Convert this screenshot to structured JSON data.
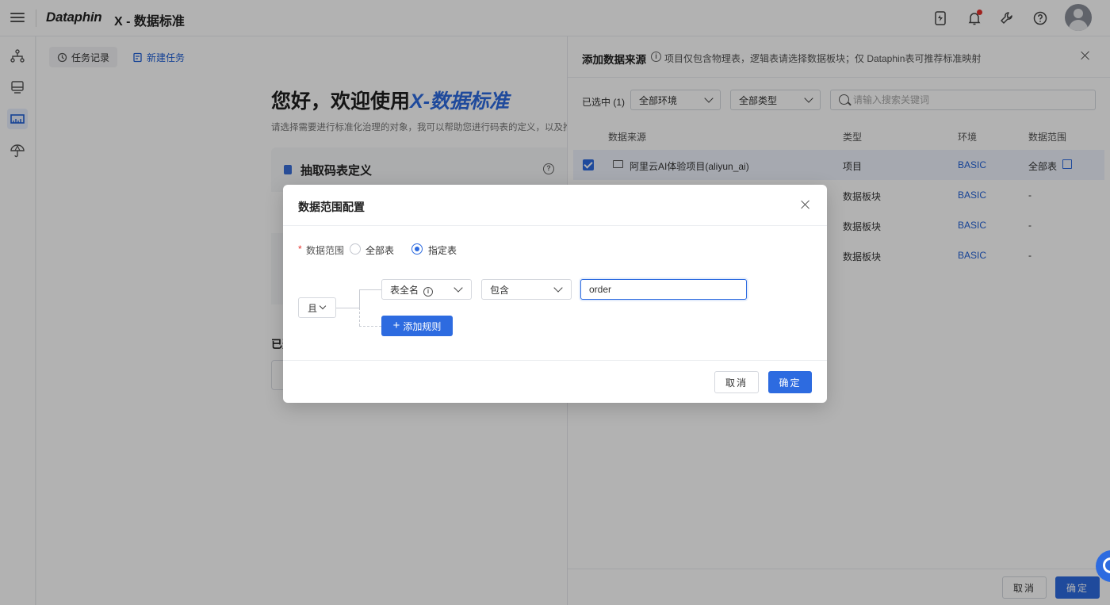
{
  "app": {
    "logo": "Dataphin",
    "title": "X - 数据标准"
  },
  "main": {
    "tabs": [
      {
        "label": "任务记录",
        "icon": "history-icon"
      },
      {
        "label": "新建任务",
        "icon": "new-task-icon"
      }
    ],
    "welcome_prefix": "您好，欢迎使用",
    "welcome_brand": "X-数据标准",
    "welcome_sub": "请选择需要进行标准化治理的对象，我可以帮助您进行码表的定义，以及推",
    "card_title": "抽取码表定义",
    "selected_label": "已选"
  },
  "drawer": {
    "title": "添加数据来源",
    "hint": "项目仅包含物理表，逻辑表请选择数据板块；仅 Dataphin表可推荐标准映射",
    "selected_count": "已选中 (1)",
    "env_filter": "全部环境",
    "type_filter": "全部类型",
    "search_placeholder": "请输入搜索关键词",
    "columns": [
      "数据来源",
      "类型",
      "环境",
      "数据范围"
    ],
    "rows": [
      {
        "source": "阿里云AI体验项目(aliyun_ai)",
        "type": "项目",
        "env": "BASIC",
        "scope": "全部表",
        "checked": true
      },
      {
        "source": "",
        "type": "数据板块",
        "env": "BASIC",
        "scope": "-",
        "checked": false
      },
      {
        "source": "",
        "type": "数据板块",
        "env": "BASIC",
        "scope": "-",
        "checked": false
      },
      {
        "source": "",
        "type": "数据板块",
        "env": "BASIC",
        "scope": "-",
        "checked": false
      }
    ],
    "cancel": "取消",
    "confirm": "确定"
  },
  "modal": {
    "title": "数据范围配置",
    "field_label": "数据范围",
    "option_all": "全部表",
    "option_specified": "指定表",
    "selected_option": "指定表",
    "logic": "且",
    "rule_field": "表全名",
    "rule_operator": "包含",
    "rule_value": "order",
    "add_rule": "添加规则",
    "cancel": "取消",
    "confirm": "确定"
  },
  "colors": {
    "primary": "#2d6be0",
    "notify_dot": "#e5322d"
  }
}
